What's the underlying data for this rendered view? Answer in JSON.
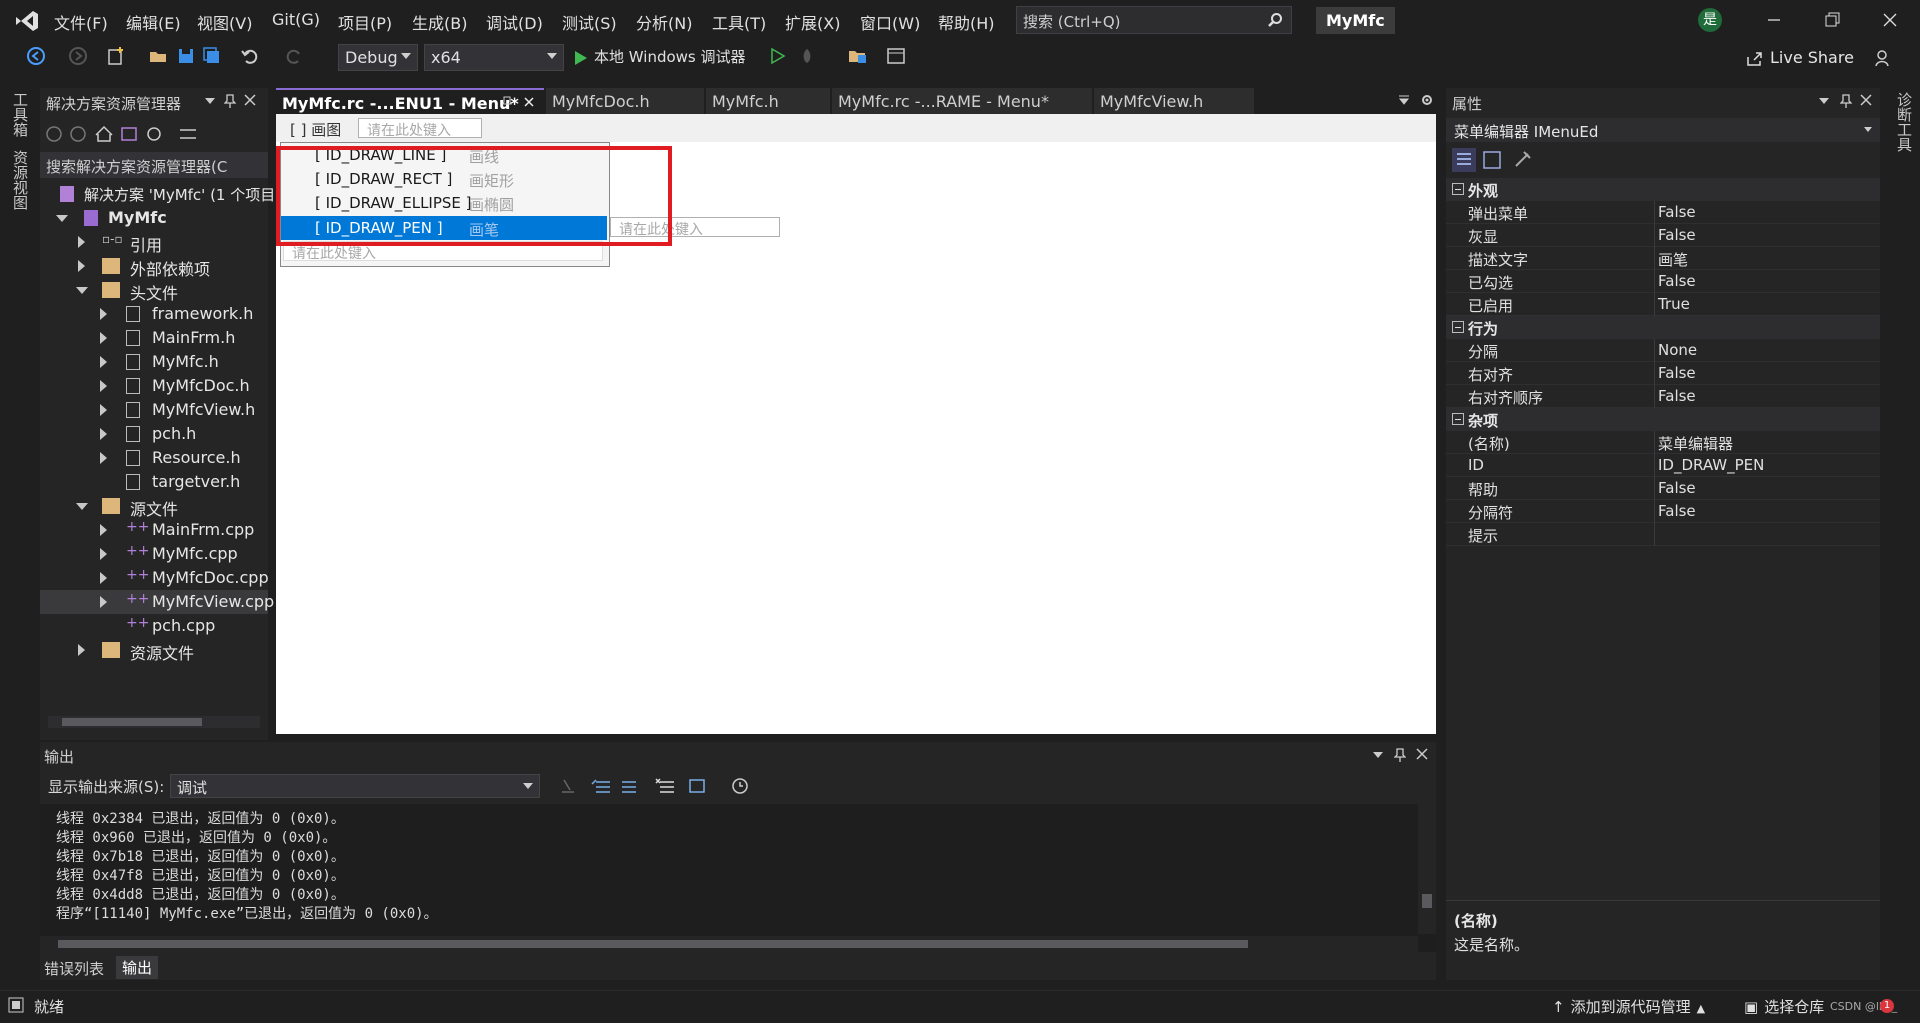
{
  "menu": {
    "items": [
      "文件(F)",
      "编辑(E)",
      "视图(V)",
      "Git(G)",
      "项目(P)",
      "生成(B)",
      "调试(D)",
      "测试(S)",
      "分析(N)",
      "工具(T)",
      "扩展(X)",
      "窗口(W)",
      "帮助(H)"
    ],
    "search_placeholder": "搜索 (Ctrl+Q)",
    "solution_name": "MyMfc",
    "user_initial": "是"
  },
  "toolbar": {
    "config": "Debug",
    "platform": "x64",
    "run_label": "本地 Windows 调试器",
    "live_share": "Live Share"
  },
  "left_strip": {
    "toolbox": "工具箱",
    "resource_view": "资源视图"
  },
  "right_strip": {
    "diagnostics": "诊断工具"
  },
  "solution_explorer": {
    "title": "解决方案资源管理器",
    "search": "搜索解决方案资源管理器(C",
    "solution": "解决方案 'MyMfc' (1 个项目",
    "project": "MyMfc",
    "nodes": {
      "refs": "引用",
      "extdeps": "外部依赖项",
      "headers": "头文件",
      "h1": "framework.h",
      "h2": "MainFrm.h",
      "h3": "MyMfc.h",
      "h4": "MyMfcDoc.h",
      "h5": "MyMfcView.h",
      "h6": "pch.h",
      "h7": "Resource.h",
      "h8": "targetver.h",
      "sources": "源文件",
      "c1": "MainFrm.cpp",
      "c2": "MyMfc.cpp",
      "c3": "MyMfcDoc.cpp",
      "c4": "MyMfcView.cpp",
      "c5": "pch.cpp",
      "resources": "资源文件"
    }
  },
  "tabs": [
    "MyMfc.rc -...ENU1 - Menu*",
    "MyMfcDoc.h",
    "MyMfc.h",
    "MyMfc.rc -...RAME - Menu*",
    "MyMfcView.h"
  ],
  "editor": {
    "top_menu_label": "[ ] 画图",
    "type_here": "请在此处键入",
    "items": [
      {
        "id": "[ ID_DRAW_LINE ]",
        "caption": "画线"
      },
      {
        "id": "[ ID_DRAW_RECT ]",
        "caption": "画矩形"
      },
      {
        "id": "[ ID_DRAW_ELLIPSE ]",
        "caption": "画椭圆"
      },
      {
        "id": "[ ID_DRAW_PEN ]",
        "caption": "画笔"
      }
    ],
    "highlight_color": "#e11b22",
    "selection_color": "#0078d7"
  },
  "properties": {
    "title": "属性",
    "object": "菜单编辑器  IMenuEd",
    "cat_appearance": "外观",
    "cat_behavior": "行为",
    "cat_misc": "杂项",
    "appearance": [
      {
        "k": "弹出菜单",
        "v": "False"
      },
      {
        "k": "灰显",
        "v": "False"
      },
      {
        "k": "描述文字",
        "v": "画笔"
      },
      {
        "k": "已勾选",
        "v": "False"
      },
      {
        "k": "已启用",
        "v": "True"
      }
    ],
    "behavior": [
      {
        "k": "分隔",
        "v": "None"
      },
      {
        "k": "右对齐",
        "v": "False"
      },
      {
        "k": "右对齐顺序",
        "v": "False"
      }
    ],
    "misc": [
      {
        "k": "(名称)",
        "v": "菜单编辑器"
      },
      {
        "k": "ID",
        "v": "ID_DRAW_PEN"
      },
      {
        "k": "帮助",
        "v": "False"
      },
      {
        "k": "分隔符",
        "v": "False"
      },
      {
        "k": "提示",
        "v": ""
      }
    ],
    "desc_title": "(名称)",
    "desc_text": "这是名称。"
  },
  "output": {
    "title": "输出",
    "source_label": "显示输出来源(S):",
    "source_value": "调试",
    "lines": [
      "线程 0x2384 已退出，返回值为 0 (0x0)。",
      "线程 0x960 已退出，返回值为 0 (0x0)。",
      "线程 0x7b18 已退出，返回值为 0 (0x0)。",
      "线程 0x47f8 已退出，返回值为 0 (0x0)。",
      "线程 0x4dd8 已退出，返回值为 0 (0x0)。",
      "程序“[11140] MyMfc.exe”已退出，返回值为 0 (0x0)。"
    ],
    "tab_errors": "错误列表",
    "tab_output": "输出"
  },
  "status": {
    "ready": "就绪",
    "add_source": "添加到源代码管理",
    "select_repo": "选择仓库",
    "watermark": "CSDN @lkk_",
    "notif_count": "1"
  }
}
